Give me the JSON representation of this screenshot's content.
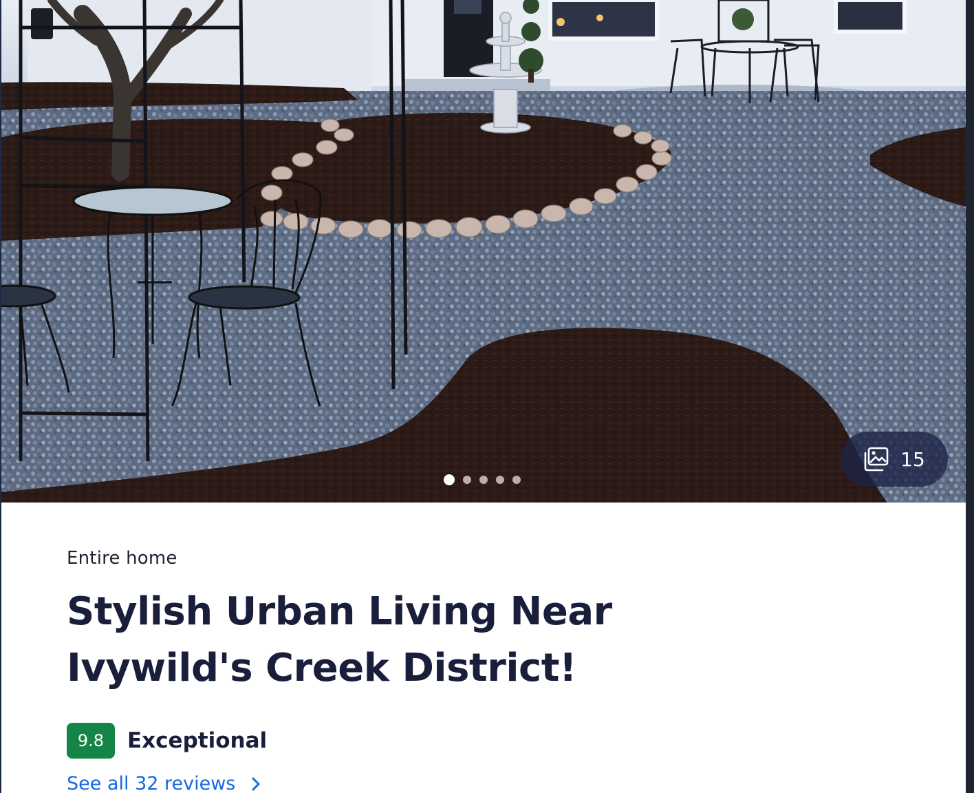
{
  "listing": {
    "property_type": "Entire home",
    "title": "Stylish Urban Living Near Ivywild's Creek District!",
    "rating": {
      "score": "9.8",
      "label": "Exceptional",
      "badge_color": "#158547"
    },
    "reviews_link": "See all 32 reviews"
  },
  "gallery": {
    "photo_count": "15",
    "icon": "gallery-icon",
    "total_dots": 5,
    "active_dot": 0,
    "photo_alt": "Backyard with gravel landscaping, mulch beds edged with stones, stone fountain, and wrought-iron bistro tables and chairs"
  },
  "colors": {
    "link": "#1668e3",
    "heading": "#191e3b"
  },
  "icons": {
    "reviews_chevron": "chevron-right-icon"
  }
}
